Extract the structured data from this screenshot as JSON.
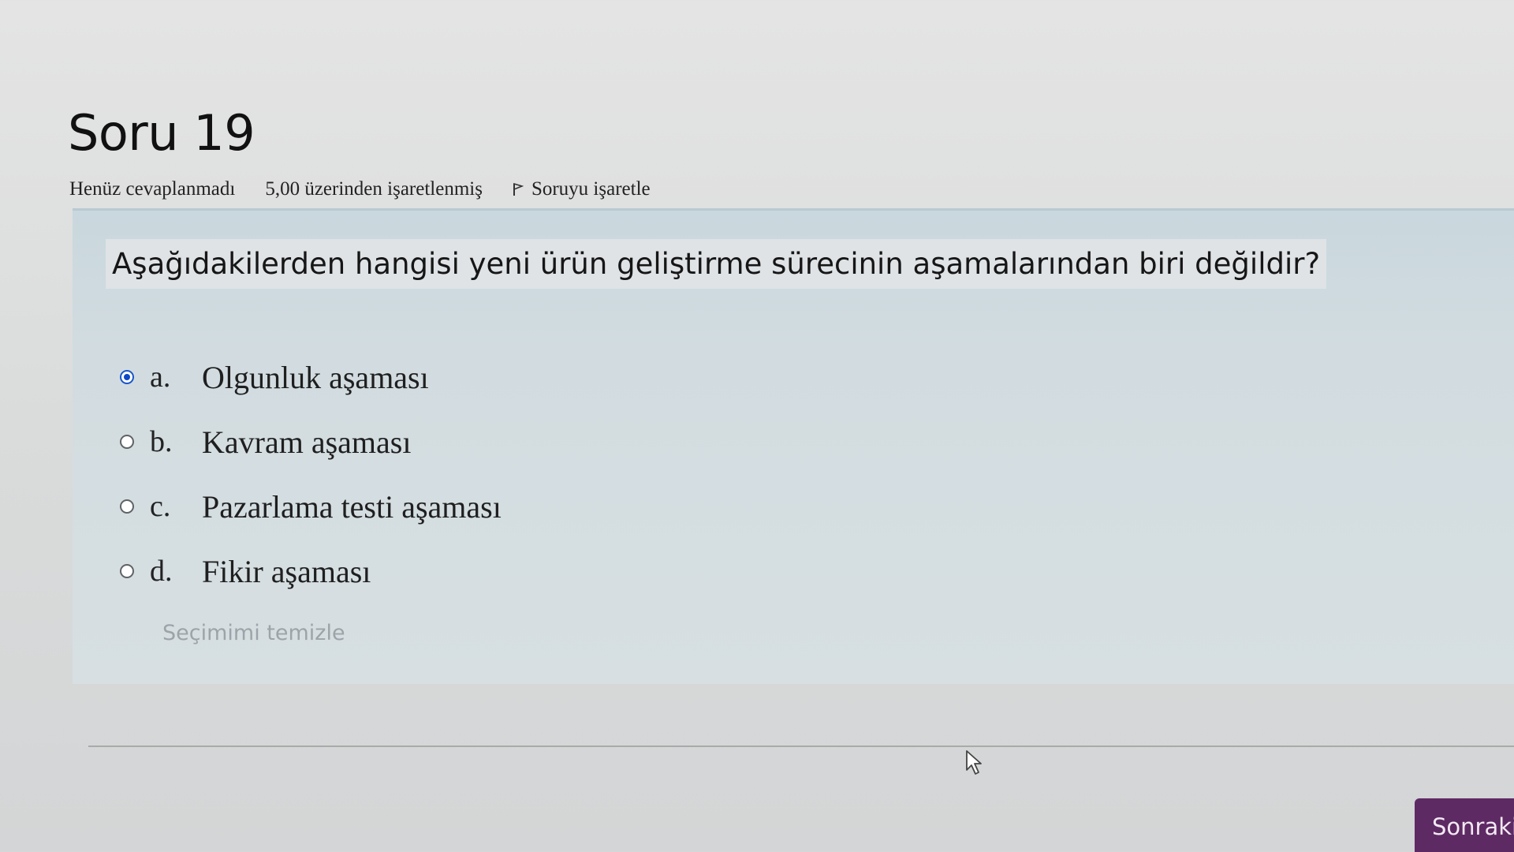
{
  "question": {
    "title": "Soru 19",
    "status": "Henüz cevaplanmadı",
    "grade": "5,00 üzerinden işaretlenmiş",
    "flag_label": "Soruyu işaretle",
    "text": "Aşağıdakilerden hangisi yeni ürün geliştirme sürecinin aşamalarından biri değildir?",
    "answers": [
      {
        "letter": "a.",
        "text": "Olgunluk aşaması",
        "selected": true
      },
      {
        "letter": "b.",
        "text": "Kavram aşaması",
        "selected": false
      },
      {
        "letter": "c.",
        "text": "Pazarlama testi aşaması",
        "selected": false
      },
      {
        "letter": "d.",
        "text": "Fikir aşaması",
        "selected": false
      }
    ],
    "clear_choice_label": "Seçimimi temizle"
  },
  "navigation": {
    "next_label": "Sonraki"
  },
  "colors": {
    "selected_radio": "#0f47c8",
    "next_button": "#5e2a64",
    "question_box": "#d2dce0"
  },
  "icons": {
    "flag": "flag-icon",
    "cursor": "mouse-pointer-icon"
  }
}
